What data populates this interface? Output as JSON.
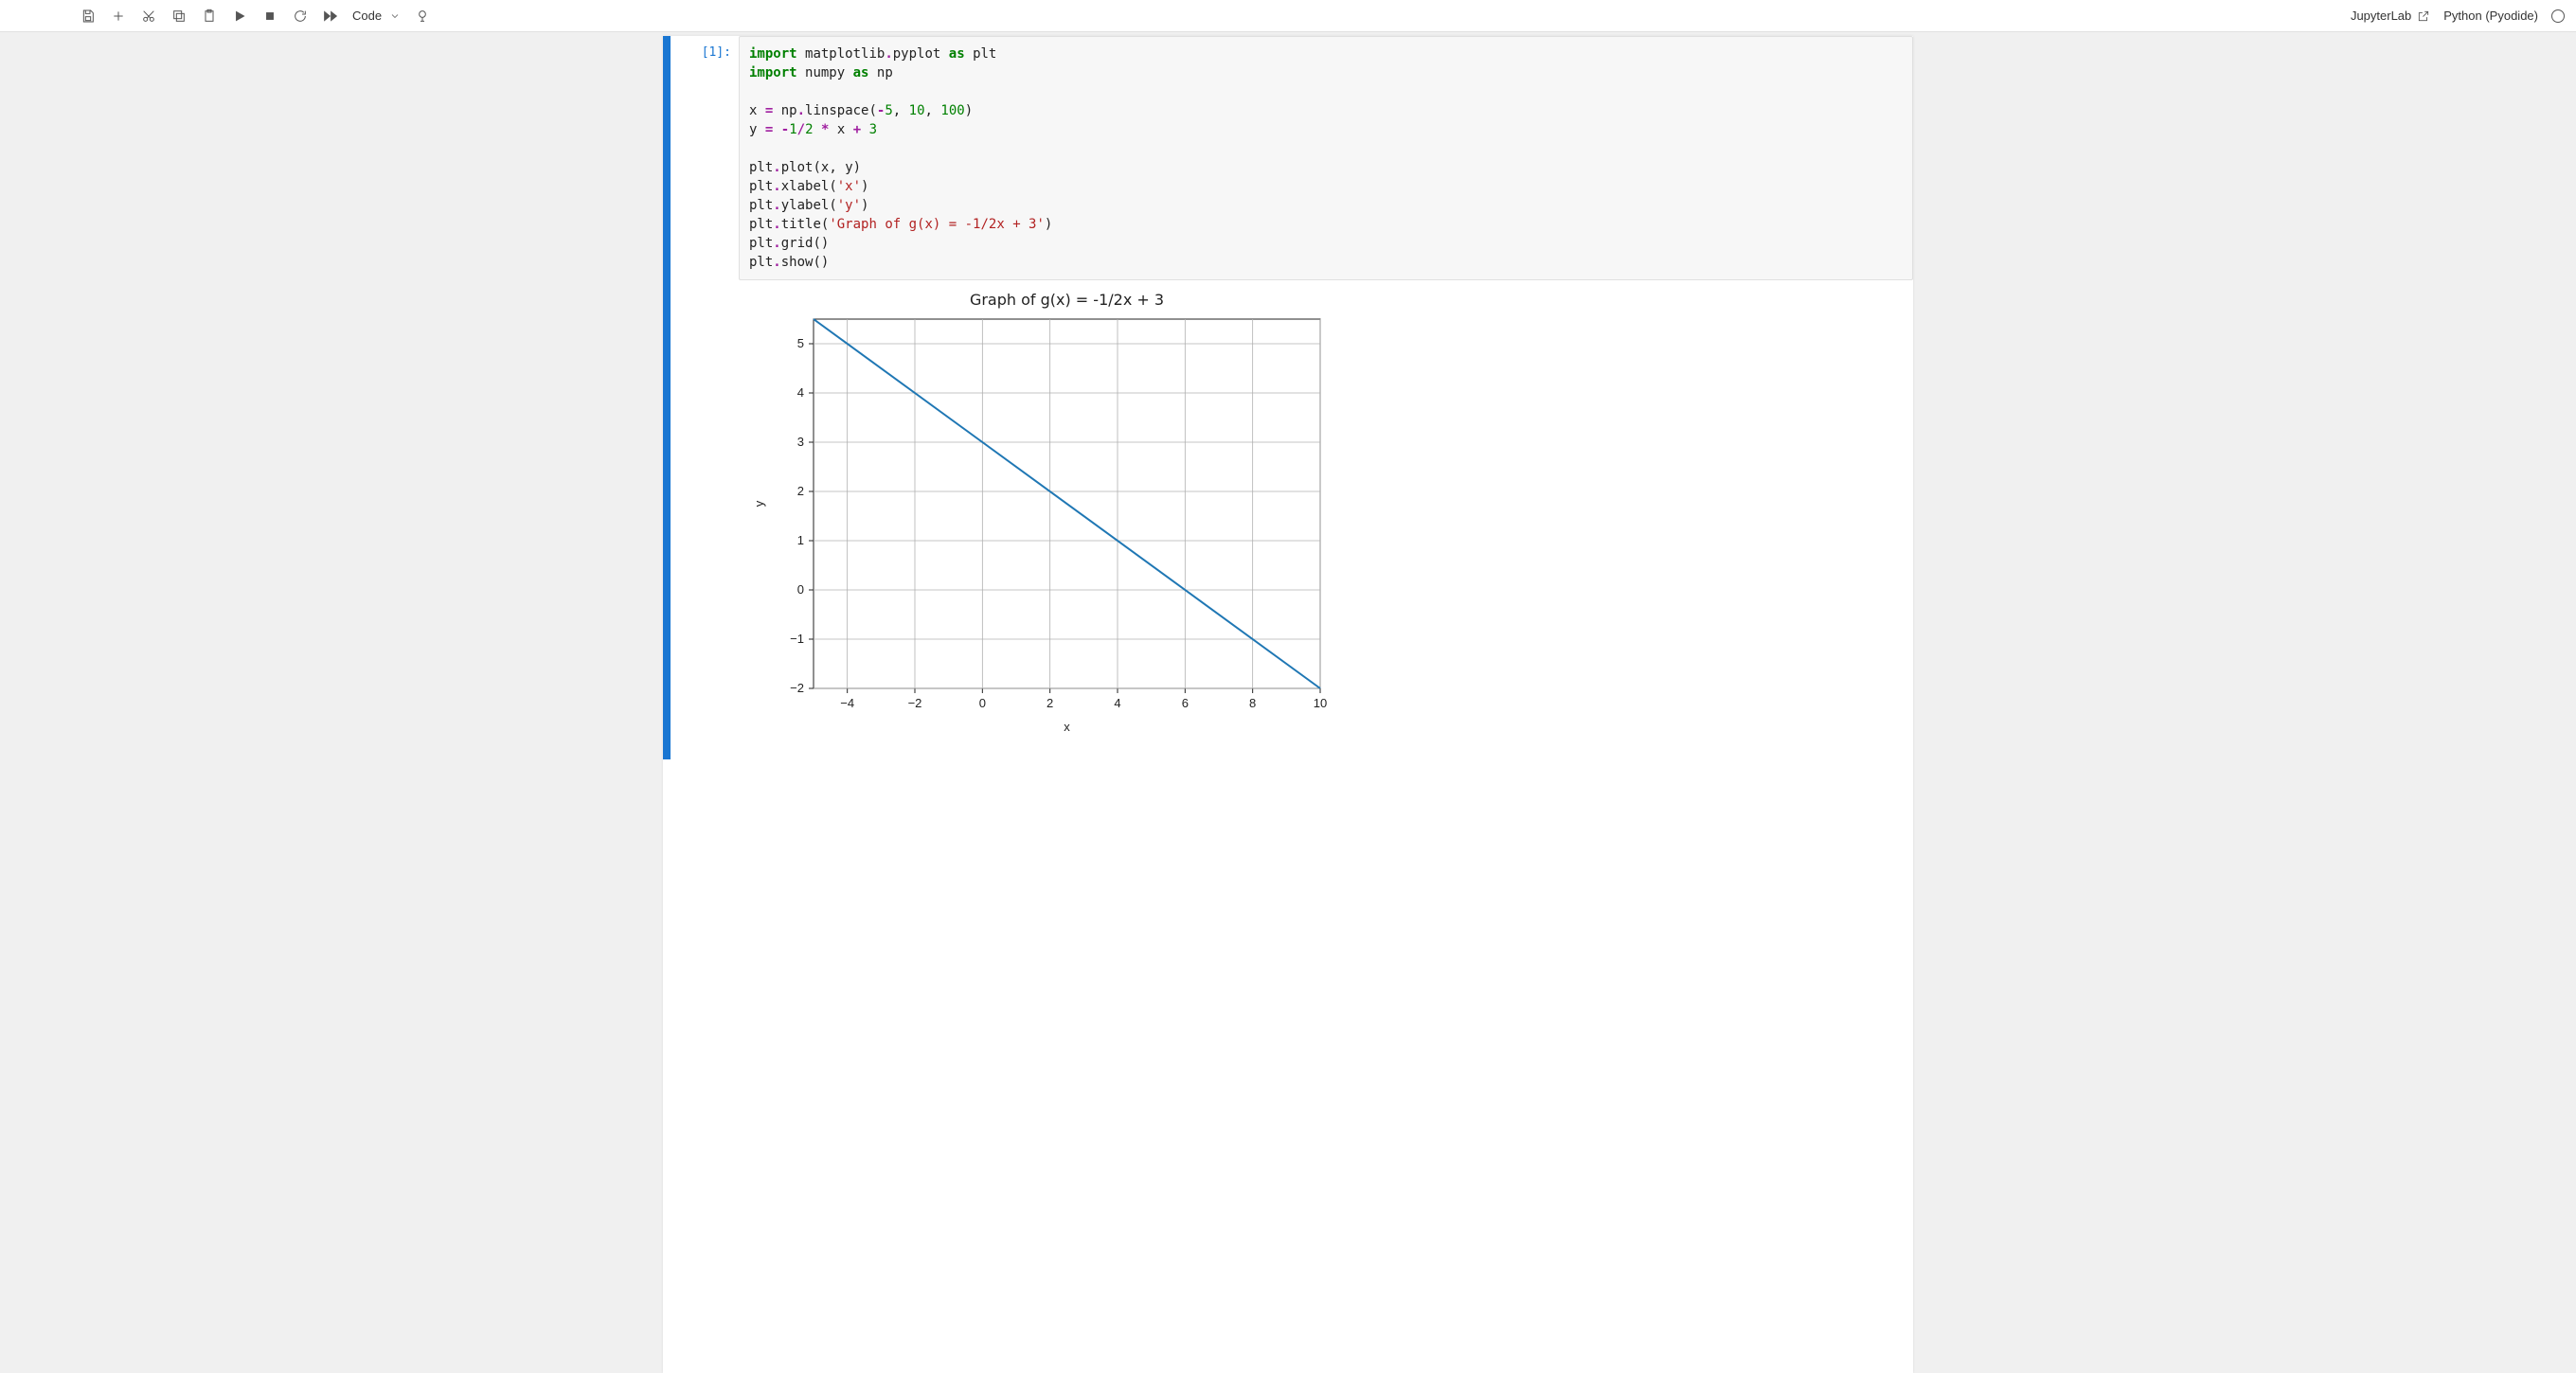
{
  "toolbar": {
    "cell_type": "Code",
    "jupyterlab_label": "JupyterLab",
    "kernel_label": "Python (Pyodide)"
  },
  "cell": {
    "prompt": "[1]:",
    "code_tokens": [
      [
        [
          "kw",
          "import"
        ],
        [
          "sp",
          " "
        ],
        [
          "nm",
          "matplotlib"
        ],
        [
          "op",
          "."
        ],
        [
          "nm",
          "pyplot"
        ],
        [
          "sp",
          " "
        ],
        [
          "kw",
          "as"
        ],
        [
          "sp",
          " "
        ],
        [
          "nm",
          "plt"
        ]
      ],
      [
        [
          "kw",
          "import"
        ],
        [
          "sp",
          " "
        ],
        [
          "nm",
          "numpy"
        ],
        [
          "sp",
          " "
        ],
        [
          "kw",
          "as"
        ],
        [
          "sp",
          " "
        ],
        [
          "nm",
          "np"
        ]
      ],
      [],
      [
        [
          "nm",
          "x"
        ],
        [
          "sp",
          " "
        ],
        [
          "op",
          "="
        ],
        [
          "sp",
          " "
        ],
        [
          "nm",
          "np"
        ],
        [
          "op",
          "."
        ],
        [
          "nm",
          "linspace"
        ],
        [
          "nm",
          "("
        ],
        [
          "op",
          "-"
        ],
        [
          "num",
          "5"
        ],
        [
          "nm",
          ","
        ],
        [
          "sp",
          " "
        ],
        [
          "num",
          "10"
        ],
        [
          "nm",
          ","
        ],
        [
          "sp",
          " "
        ],
        [
          "num",
          "100"
        ],
        [
          "nm",
          ")"
        ]
      ],
      [
        [
          "nm",
          "y"
        ],
        [
          "sp",
          " "
        ],
        [
          "op",
          "="
        ],
        [
          "sp",
          " "
        ],
        [
          "op",
          "-"
        ],
        [
          "num",
          "1"
        ],
        [
          "op",
          "/"
        ],
        [
          "num",
          "2"
        ],
        [
          "sp",
          " "
        ],
        [
          "op",
          "*"
        ],
        [
          "sp",
          " "
        ],
        [
          "nm",
          "x"
        ],
        [
          "sp",
          " "
        ],
        [
          "op",
          "+"
        ],
        [
          "sp",
          " "
        ],
        [
          "num",
          "3"
        ]
      ],
      [],
      [
        [
          "nm",
          "plt"
        ],
        [
          "op",
          "."
        ],
        [
          "nm",
          "plot"
        ],
        [
          "nm",
          "("
        ],
        [
          "nm",
          "x"
        ],
        [
          "nm",
          ","
        ],
        [
          "sp",
          " "
        ],
        [
          "nm",
          "y"
        ],
        [
          "nm",
          ")"
        ]
      ],
      [
        [
          "nm",
          "plt"
        ],
        [
          "op",
          "."
        ],
        [
          "nm",
          "xlabel"
        ],
        [
          "nm",
          "("
        ],
        [
          "str",
          "'x'"
        ],
        [
          "nm",
          ")"
        ]
      ],
      [
        [
          "nm",
          "plt"
        ],
        [
          "op",
          "."
        ],
        [
          "nm",
          "ylabel"
        ],
        [
          "nm",
          "("
        ],
        [
          "str",
          "'y'"
        ],
        [
          "nm",
          ")"
        ]
      ],
      [
        [
          "nm",
          "plt"
        ],
        [
          "op",
          "."
        ],
        [
          "nm",
          "title"
        ],
        [
          "nm",
          "("
        ],
        [
          "str",
          "'Graph of g(x) = -1/2x + 3'"
        ],
        [
          "nm",
          ")"
        ]
      ],
      [
        [
          "nm",
          "plt"
        ],
        [
          "op",
          "."
        ],
        [
          "nm",
          "grid"
        ],
        [
          "nm",
          "()"
        ]
      ],
      [
        [
          "nm",
          "plt"
        ],
        [
          "op",
          "."
        ],
        [
          "nm",
          "show"
        ],
        [
          "nm",
          "()"
        ]
      ]
    ]
  },
  "chart_data": {
    "type": "line",
    "title": "Graph of g(x) = -1/2x + 3",
    "xlabel": "x",
    "ylabel": "y",
    "xlim": [
      -5,
      10
    ],
    "ylim": [
      -2,
      5.5
    ],
    "xticks": [
      -4,
      -2,
      0,
      2,
      4,
      6,
      8,
      10
    ],
    "yticks": [
      -2,
      -1,
      0,
      1,
      2,
      3,
      4,
      5
    ],
    "series": [
      {
        "name": "g(x)",
        "x": [
          -5,
          10
        ],
        "y": [
          5.5,
          -2
        ],
        "color": "#1f77b4"
      }
    ],
    "grid": true
  }
}
